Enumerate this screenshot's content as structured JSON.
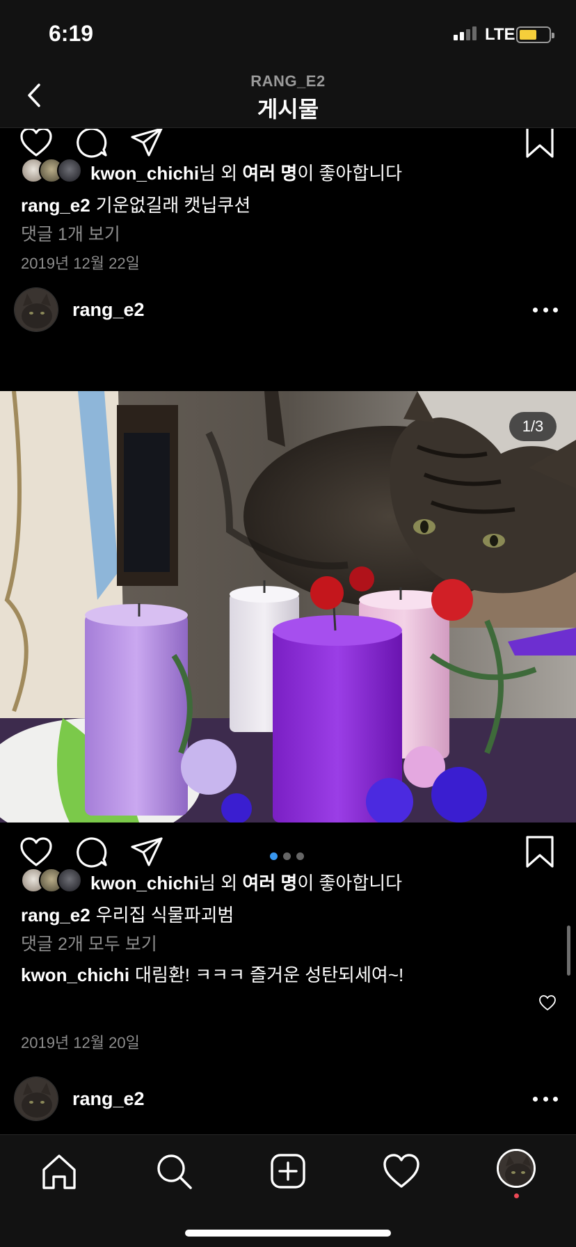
{
  "status_bar": {
    "time": "6:19",
    "network": "LTE",
    "signal_bars": 2,
    "battery_color": "#f5cf3b"
  },
  "nav": {
    "subtitle": "RANG_E2",
    "title": "게시물"
  },
  "post1": {
    "likes": {
      "user": "kwon_chichi",
      "suffix": "님 외 ",
      "bold": "여러 명",
      "end": "이 좋아합니다"
    },
    "caption": {
      "user": "rang_e2",
      "text": "기운없길래 캣닙쿠션"
    },
    "comments_link": "댓글 1개 보기",
    "date": "2019년 12월 22일"
  },
  "post2": {
    "username": "rang_e2",
    "photo": {
      "counter": "1/3",
      "carousel_count": 3,
      "active_index": 0
    },
    "likes": {
      "user": "kwon_chichi",
      "suffix": "님 외 ",
      "bold": "여러 명",
      "end": "이 좋아합니다"
    },
    "caption": {
      "user": "rang_e2",
      "text": "우리집 식물파괴범"
    },
    "comments_link": "댓글 2개 모두 보기",
    "top_comment": {
      "user": "kwon_chichi",
      "text": "대림환! ㅋㅋㅋ 즐거운 성탄되세여~!"
    },
    "date": "2019년 12월 20일"
  },
  "post3": {
    "username": "rang_e2"
  },
  "icons": {
    "like": "heart-icon",
    "comment": "comment-icon",
    "share": "paper-plane-icon",
    "save": "bookmark-icon",
    "home": "home-icon",
    "search": "search-icon",
    "add": "add-post-icon",
    "activity": "heart-icon",
    "more": "ellipsis-icon"
  },
  "colors": {
    "accent": "#3897f0",
    "muted": "#8e8e8e",
    "notification": "#ed4956"
  }
}
